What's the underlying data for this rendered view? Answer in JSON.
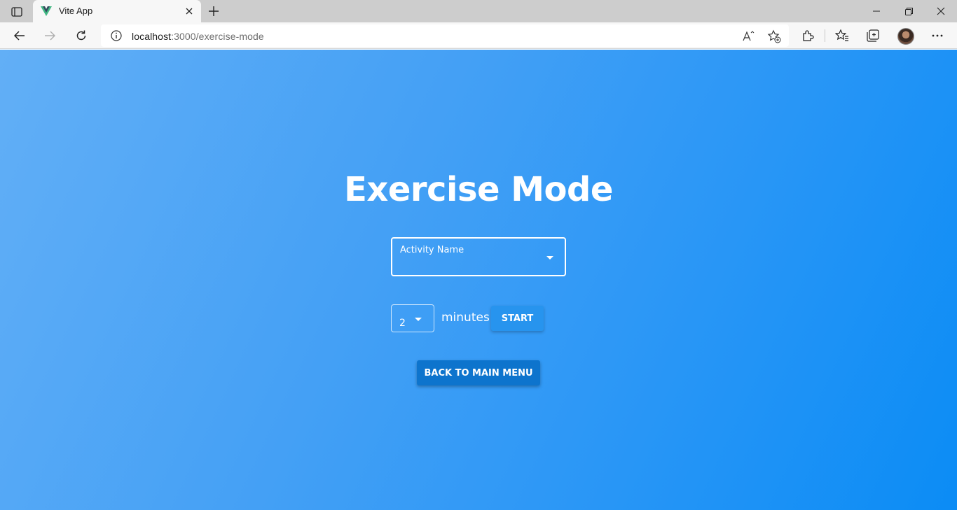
{
  "browser": {
    "tab_title": "Vite App",
    "url_host": "localhost",
    "url_rest": ":3000/exercise-mode",
    "icons": [
      "tab-actions-icon",
      "vite-favicon-icon",
      "close-icon",
      "plus-icon",
      "minimize-icon",
      "restore-icon",
      "close-window-icon",
      "back-arrow-icon",
      "forward-arrow-icon",
      "reload-icon",
      "info-icon",
      "read-aloud-icon",
      "add-favorite-icon",
      "extensions-icon",
      "favorites-icon",
      "collections-icon",
      "profile-avatar",
      "more-icon"
    ]
  },
  "page": {
    "title": "Exercise Mode",
    "activity_label": "Activity Name",
    "minutes_value": "2",
    "minutes_label": "minutes",
    "start_label": "START",
    "back_label": "BACK TO MAIN MENU"
  },
  "colors": {
    "gradient_start": "#62aff6",
    "gradient_end": "#0b8cf5",
    "start_button": "#2794ee",
    "back_button": "#0d74cd"
  }
}
